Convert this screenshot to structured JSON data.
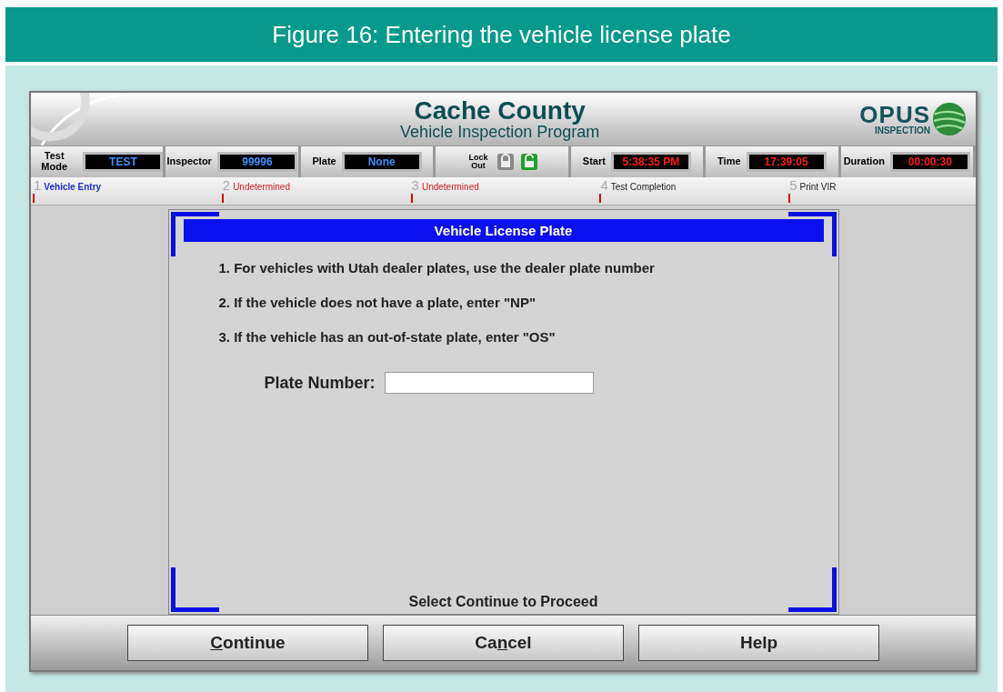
{
  "figure_title": "Figure 16: Entering the vehicle license plate",
  "app": {
    "title": "Cache County",
    "subtitle": "Vehicle Inspection Program",
    "logo": {
      "name": "OPUS",
      "tag": "INSPECTION"
    }
  },
  "status_bar": [
    {
      "kind": "field",
      "label": "Test Mode",
      "value": "TEST"
    },
    {
      "kind": "field",
      "label": "Inspector",
      "value": "99996"
    },
    {
      "kind": "field",
      "label": "Plate",
      "value": "None"
    },
    {
      "kind": "lock",
      "label": "Lock Out"
    },
    {
      "kind": "clock",
      "label": "Start",
      "value": "5:38:35 PM"
    },
    {
      "kind": "clock",
      "label": "Time",
      "value": "17:39:05"
    },
    {
      "kind": "clock",
      "label": "Duration",
      "value": "00:00:30"
    }
  ],
  "steps": [
    {
      "number": "1",
      "label": "Vehicle Entry",
      "kind": "current"
    },
    {
      "number": "2",
      "label": "Undetermined",
      "kind": "undetermined"
    },
    {
      "number": "3",
      "label": "Undetermined",
      "kind": "undetermined"
    },
    {
      "number": "4",
      "label": "Test Completion",
      "kind": "pending"
    },
    {
      "number": "5",
      "label": "Print VIR",
      "kind": "pending"
    }
  ],
  "panel": {
    "title": "Vehicle License Plate",
    "instructions": [
      "1. For vehicles with Utah dealer plates, use the dealer plate number",
      "2. If the vehicle does not have a plate, enter \"NP\"",
      "3. If the vehicle has an out-of-state plate, enter \"OS\""
    ],
    "field_label": "Plate Number:",
    "footer": "Select Continue to Proceed"
  },
  "buttons": [
    {
      "key": "C",
      "after": "ontinue"
    },
    {
      "before": "Ca",
      "key": "n",
      "after": "cel"
    },
    {
      "before": "Help"
    }
  ]
}
